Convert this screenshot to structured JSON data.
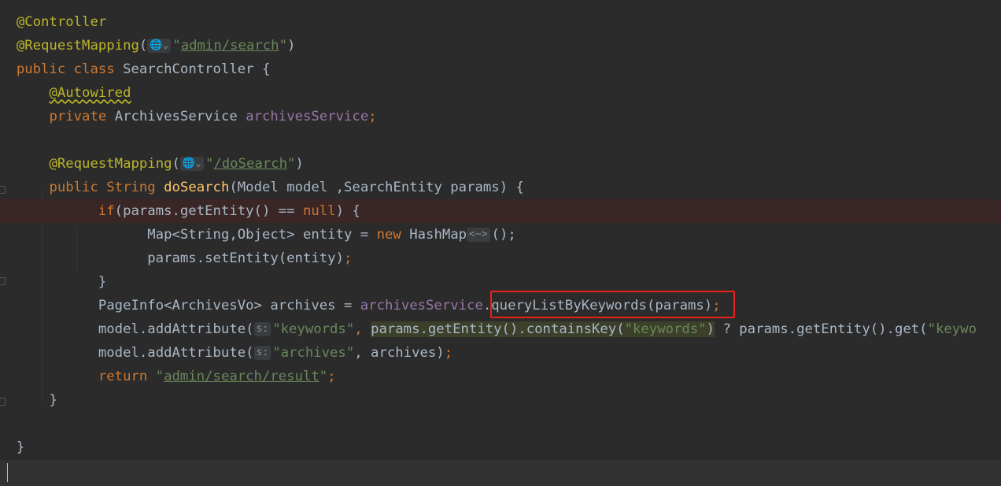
{
  "code": {
    "l1": {
      "ann": "@Controller"
    },
    "l2": {
      "ann": "@RequestMapping",
      "open": "(",
      "path": "admin/search",
      "close": ")"
    },
    "l3": {
      "kw1": "public",
      "kw2": "class",
      "name": "SearchController {"
    },
    "l4": {
      "ann": "@Autowired"
    },
    "l5": {
      "kw": "private",
      "type": "ArchivesService",
      "field": "archivesService",
      "semi": ";"
    },
    "l7": {
      "ann": "@RequestMapping",
      "open": "(",
      "path": "/doSearch",
      "close": ")"
    },
    "l8": {
      "kw": "public",
      "type": "String",
      "method": "doSearch",
      "params": "(Model model ,SearchEntity params) {"
    },
    "l9": {
      "kw": "if",
      "cond": "(params.getEntity() == ",
      "null": "null",
      "end": ") {"
    },
    "l10": {
      "decl": "Map<String,Object> entity = ",
      "new": "new",
      "ctor": " HashMap",
      "diamond": "<~>",
      "end": "();"
    },
    "l11": {
      "text": "params.setEntity(entity)",
      "semi": ";"
    },
    "l12": {
      "text": "}"
    },
    "l13": {
      "decl": "PageInfo<ArchivesVo> archives = ",
      "field": "archivesService",
      "dot": ".",
      "call": "queryListByKeywords(params)",
      "semi": ";"
    },
    "l14": {
      "call": "model.addAttribute(",
      "hint": "s:",
      "str1": "\"keywords\"",
      "comma": ", ",
      "cond": "params.getEntity().containsKey(",
      "str2": "\"keywords\"",
      "condend": ")",
      "rest": " ? params.getEntity().get(",
      "str3": "\"keywo"
    },
    "l15": {
      "call": "model.addAttribute(",
      "hint": "s:",
      "str": "\"archives\"",
      "rest": ", archives)",
      "semi": ";"
    },
    "l16": {
      "kw": "return",
      "q1": "\"",
      "path": "admin/search/result",
      "q2": "\"",
      "semi": ";"
    },
    "l17": {
      "text": "}"
    },
    "l19": {
      "text": "}"
    }
  },
  "colors": {
    "background": "#2b2b2b",
    "keyword": "#cc7832",
    "annotation": "#bbb529",
    "string": "#6a8759",
    "field": "#9876aa",
    "method": "#ffc66d",
    "highlight_box": "#e8221b"
  },
  "icons": {
    "globe": "globe-icon",
    "chevron": "chevron-down-icon"
  }
}
